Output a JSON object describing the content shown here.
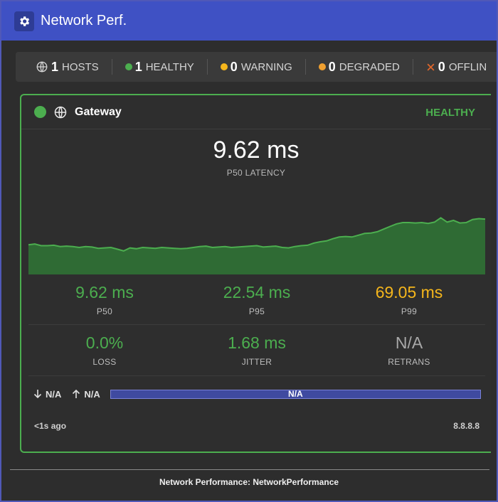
{
  "header": {
    "title": "Network Perf.",
    "icon": "gear-icon"
  },
  "summary": [
    {
      "key": "hosts",
      "count": "1",
      "label": "HOSTS",
      "icon": "globe-icon"
    },
    {
      "key": "healthy",
      "count": "1",
      "label": "HEALTHY",
      "color": "#4cae4f"
    },
    {
      "key": "warning",
      "count": "0",
      "label": "WARNING",
      "color": "#f5b61c"
    },
    {
      "key": "degraded",
      "count": "0",
      "label": "DEGRADED",
      "color": "#f0a030"
    },
    {
      "key": "offline",
      "count": "0",
      "label": "OFFLIN",
      "color": "#e0662a",
      "icon": "x-icon"
    }
  ],
  "card": {
    "name": "Gateway",
    "status": "HEALTHY",
    "status_color": "#4cae4f",
    "latency_value": "9.62 ms",
    "latency_label": "P50 LATENCY",
    "metrics_row1": [
      {
        "value": "9.62 ms",
        "label": "P50",
        "tone": "green"
      },
      {
        "value": "22.54 ms",
        "label": "P95",
        "tone": "green"
      },
      {
        "value": "69.05 ms",
        "label": "P99",
        "tone": "amber"
      }
    ],
    "metrics_row2": [
      {
        "value": "0.0%",
        "label": "LOSS",
        "tone": "green"
      },
      {
        "value": "1.68 ms",
        "label": "JITTER",
        "tone": "green"
      },
      {
        "value": "N/A",
        "label": "RETRANS",
        "tone": "grey"
      }
    ],
    "download": "N/A",
    "upload": "N/A",
    "bar_label": "N/A",
    "updated": "<1s ago",
    "target": "8.8.8.8",
    "sparkline": [
      9.4,
      9.5,
      9.3,
      9.3,
      9.35,
      9.2,
      9.25,
      9.2,
      9.1,
      9.2,
      9.15,
      9.0,
      9.05,
      9.1,
      8.9,
      8.7,
      9.05,
      8.95,
      9.1,
      9.05,
      9.0,
      9.1,
      9.05,
      9.0,
      8.95,
      9.0,
      9.1,
      9.2,
      9.25,
      9.1,
      9.15,
      9.2,
      9.1,
      9.15,
      9.2,
      9.25,
      9.3,
      9.15,
      9.2,
      9.25,
      9.1,
      9.05,
      9.2,
      9.3,
      9.35,
      9.6,
      9.75,
      9.85,
      10.1,
      10.3,
      10.35,
      10.3,
      10.5,
      10.7,
      10.75,
      10.9,
      11.2,
      11.5,
      11.8,
      11.95,
      11.95,
      11.9,
      11.95,
      11.85,
      12.0,
      12.5,
      12.0,
      12.2,
      11.9,
      11.95,
      12.3,
      12.4,
      12.35
    ]
  },
  "footer_caption": "Network Performance: NetworkPerformance"
}
